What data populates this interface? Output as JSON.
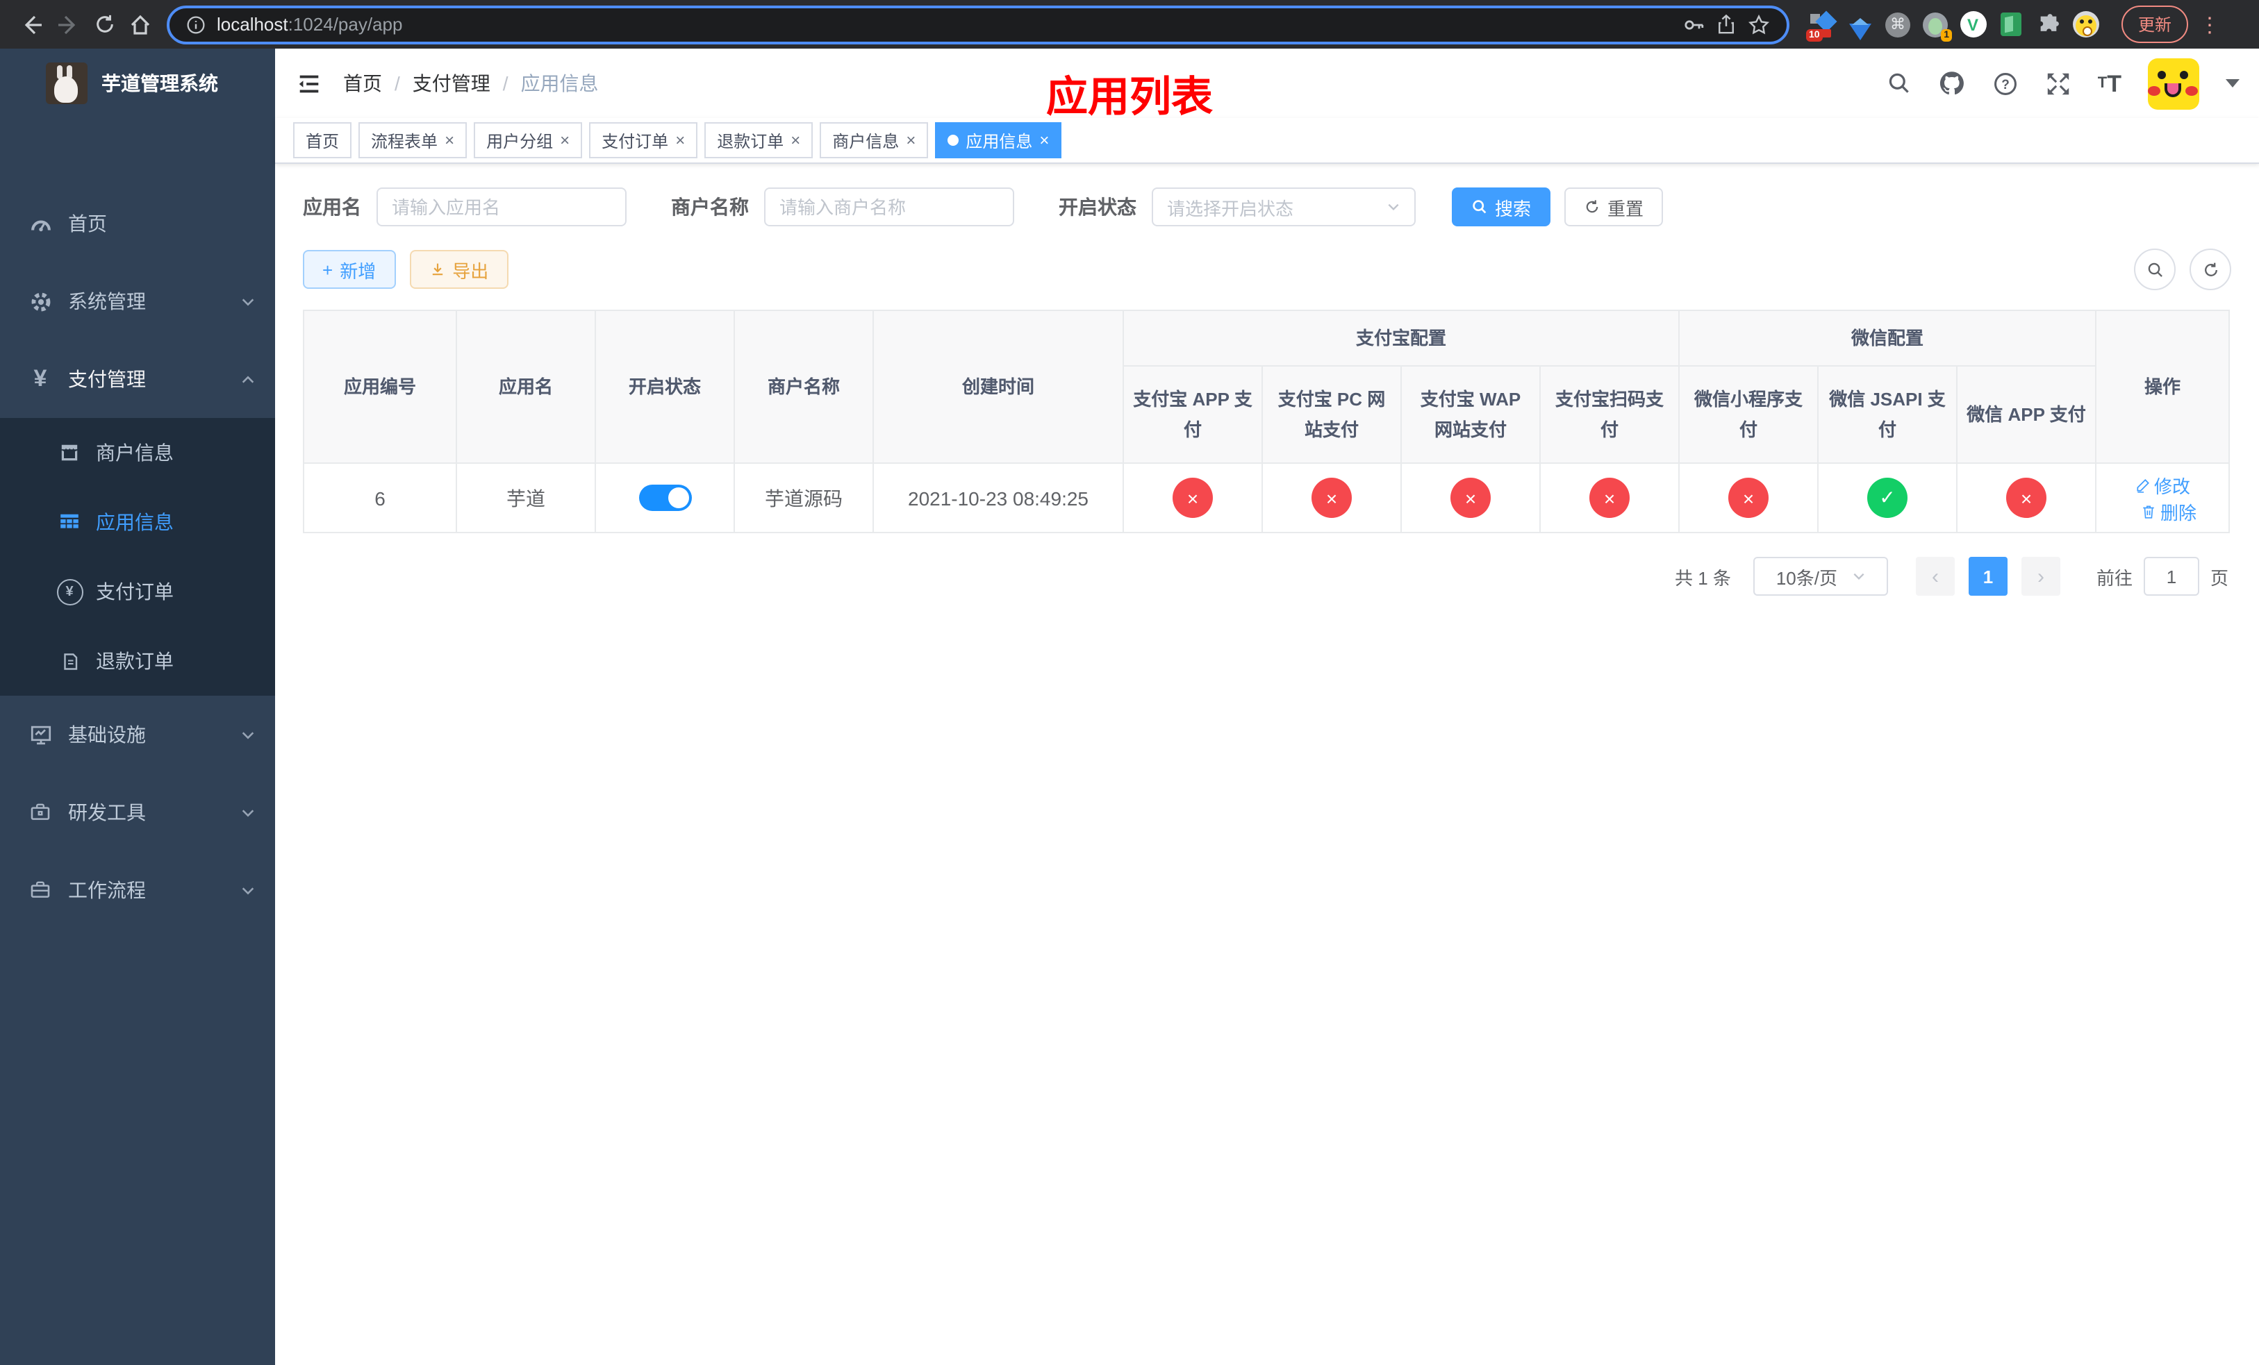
{
  "browser": {
    "url_host": "localhost",
    "url_path": ":1024/pay/app",
    "update_button": "更新",
    "ext_badge_devtools": "10",
    "ext_badge_avatar": "1",
    "vue_letter": "V",
    "cmd_glyph": "⌘"
  },
  "sidebar": {
    "title": "芋道管理系统",
    "items": {
      "home": "首页",
      "system": "系统管理",
      "pay": "支付管理",
      "merchant": "商户信息",
      "appinfo": "应用信息",
      "payorder": "支付订单",
      "refund": "退款订单",
      "infra": "基础设施",
      "devtool": "研发工具",
      "workflow": "工作流程"
    }
  },
  "header": {
    "breadcrumb": [
      "首页",
      "支付管理",
      "应用信息"
    ],
    "page_title": "应用列表"
  },
  "tabs": [
    "首页",
    "流程表单",
    "用户分组",
    "支付订单",
    "退款订单",
    "商户信息",
    "应用信息"
  ],
  "filters": {
    "name_label": "应用名",
    "name_placeholder": "请输入应用名",
    "merchant_label": "商户名称",
    "merchant_placeholder": "请输入商户名称",
    "status_label": "开启状态",
    "status_placeholder": "请选择开启状态",
    "search": "搜索",
    "reset": "重置"
  },
  "toolbar": {
    "add": "新增",
    "export": "导出"
  },
  "table": {
    "group_alipay": "支付宝配置",
    "group_wechat": "微信配置",
    "col_id": "应用编号",
    "col_name": "应用名",
    "col_status": "开启状态",
    "col_merchant": "商户名称",
    "col_created": "创建时间",
    "col_alipay_app": "支付宝 APP 支付",
    "col_alipay_pc": "支付宝 PC 网站支付",
    "col_alipay_wap": "支付宝 WAP 网站支付",
    "col_alipay_qr": "支付宝扫码支付",
    "col_wx_mini": "微信小程序支付",
    "col_wx_jsapi": "微信 JSAPI 支付",
    "col_wx_app": "微信 APP 支付",
    "col_actions": "操作",
    "row": {
      "id": "6",
      "name": "芋道",
      "enabled": true,
      "merchant": "芋道源码",
      "created": "2021-10-23 08:49:25",
      "statuses": [
        "no",
        "no",
        "no",
        "no",
        "no",
        "yes",
        "no"
      ],
      "edit": "修改",
      "delete": "删除"
    }
  },
  "pagination": {
    "total": "共 1 条",
    "page_size": "10条/页",
    "current": "1",
    "goto_label": "前往",
    "goto_value": "1",
    "page_unit": "页"
  },
  "colors": {
    "accent": "#409eff",
    "danger": "#f5484d",
    "success": "#13ce66",
    "sidebar_bg": "#304156",
    "submenu_bg": "#1f2d3d",
    "title_red": "#ff0000"
  }
}
